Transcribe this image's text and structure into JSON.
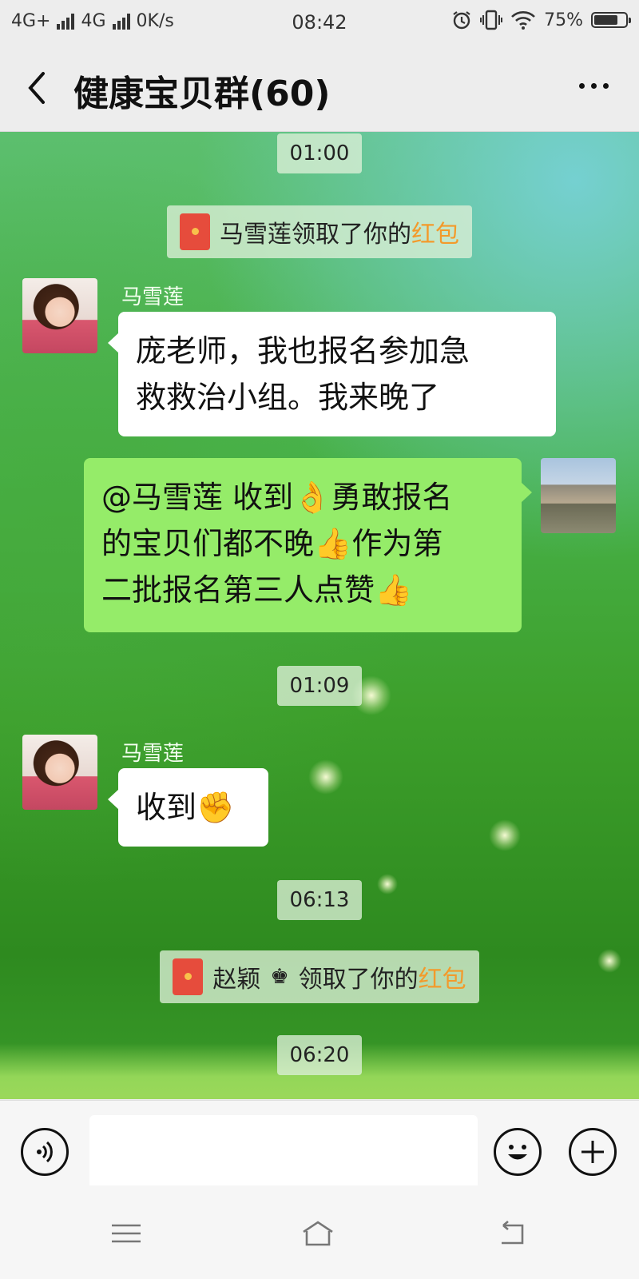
{
  "status_bar": {
    "network1": "4G+",
    "network2": "4G",
    "speed": "0K/s",
    "time": "08:42",
    "battery": "75%",
    "battery_level": 0.75,
    "icons": [
      "alarm-icon",
      "vibrate-icon",
      "wifi-icon",
      "battery-icon"
    ]
  },
  "header": {
    "title": "健康宝贝群(60)",
    "back_icon": "chevron-left-icon",
    "more_icon": "more-icon"
  },
  "messages": {
    "ts1": "01:00",
    "sys1": {
      "text": "马雪莲领取了你的",
      "highlight": "红包"
    },
    "m1": {
      "sender": "马雪莲",
      "lines": [
        "庞老师，我也报名参加急",
        "救救治小组。我来晚了"
      ]
    },
    "m2": {
      "lines": [
        "@马雪莲  收到👌勇敢报名",
        "的宝贝们都不晚👍作为第",
        "二批报名第三人点赞👍"
      ]
    },
    "ts2": "01:09",
    "m3": {
      "sender": "马雪莲",
      "text": "收到✊"
    },
    "ts3": "06:13",
    "sys2": {
      "name": "赵颖",
      "crown": "♚",
      "text": "领取了你的",
      "highlight": "红包"
    },
    "ts4": "06:20"
  },
  "input_bar": {
    "voice_icon": "voice-icon",
    "emoji_icon": "emoji-icon",
    "plus_icon": "plus-icon",
    "input_value": ""
  },
  "system_nav": [
    "menu-icon",
    "home-icon",
    "back-icon"
  ],
  "colors": {
    "outgoing_bubble": "#95ec69",
    "incoming_bubble": "#ffffff",
    "highlight": "#f39a2b",
    "red_packet": "#e64c3c"
  }
}
